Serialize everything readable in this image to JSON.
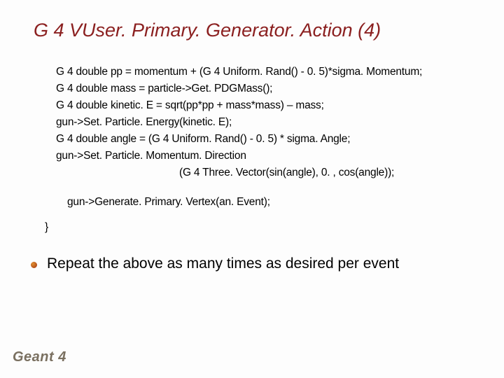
{
  "title": "G 4 VUser. Primary. Generator. Action (4)",
  "code": {
    "l1": "G 4 double pp = momentum + (G 4 Uniform. Rand() - 0. 5)*sigma. Momentum;",
    "l2": "G 4 double mass = particle->Get. PDGMass();",
    "l3": "G 4 double kinetic. E = sqrt(pp*pp + mass*mass) – mass;",
    "l4": "gun->Set. Particle. Energy(kinetic. E);",
    "l5": "G 4 double angle = (G 4 Uniform. Rand() - 0. 5) * sigma. Angle;",
    "l6": "gun->Set. Particle. Momentum. Direction",
    "l7": "(G 4 Three. Vector(sin(angle), 0. , cos(angle));",
    "gen": "gun->Generate. Primary. Vertex(an. Event);",
    "close": "}"
  },
  "bullet": "Repeat the above as many times as desired per event",
  "logo": "Geant 4"
}
